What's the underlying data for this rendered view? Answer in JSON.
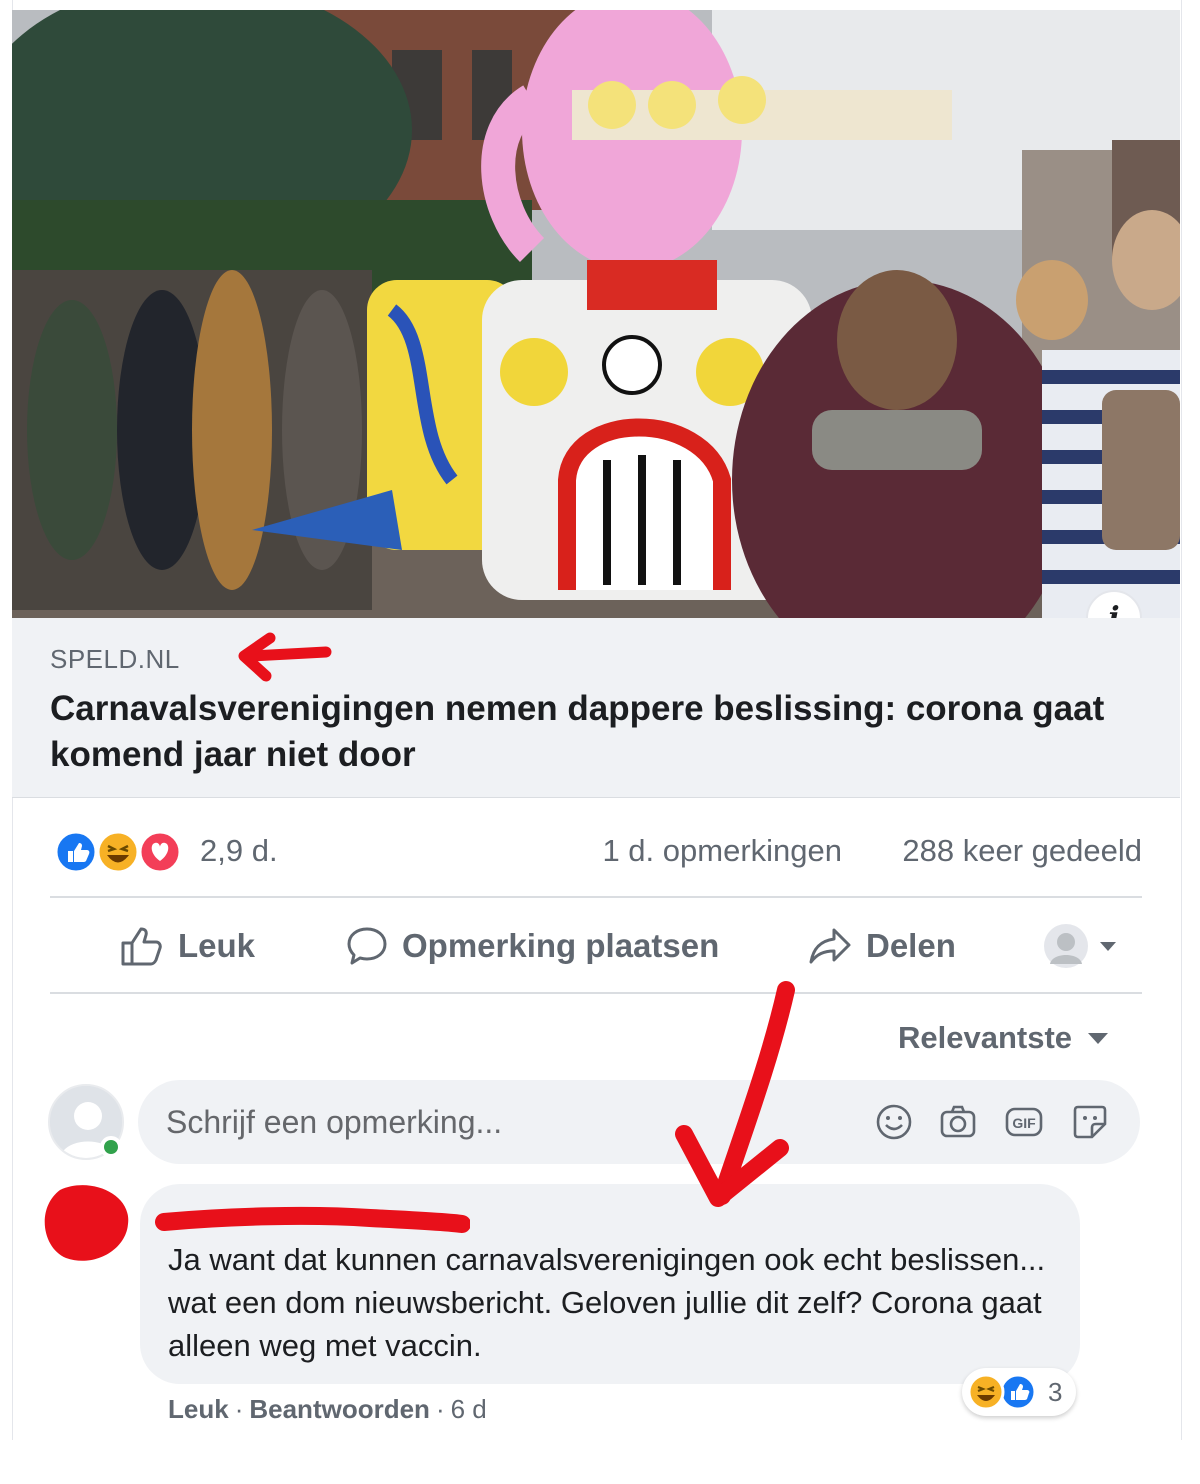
{
  "post": {
    "photo_alt": "",
    "info_icon": "i",
    "domain": "SPELD.NL",
    "headline": "Carnavalsverenigingen nemen dappere beslissing: corona gaat komend jaar niet door"
  },
  "stats": {
    "reactions": "2,9 d.",
    "comments": "1 d. opmerkingen",
    "shares": "288 keer gedeeld",
    "reaction_types": [
      "like-icon",
      "haha-icon",
      "love-icon"
    ]
  },
  "actions": {
    "like": "Leuk",
    "comment": "Opmerking plaatsen",
    "share": "Delen"
  },
  "sort_label": "Relevantste",
  "composer": {
    "placeholder": "Schrijf een opmerking...",
    "icons": [
      "emoji-icon",
      "camera-icon",
      "gif-icon",
      "sticker-icon"
    ]
  },
  "comment": {
    "text": "Ja want dat kunnen carnavalsverenigingen ook echt beslissen... wat een dom nieuwsbericht. Geloven jullie dit zelf? Corona gaat alleen weg met vaccin.",
    "reaction_count": "3",
    "like_label": "Leuk",
    "reply_label": "Beantwoorden",
    "time": "6 d",
    "sep": "·"
  },
  "colors": {
    "annotation_red": "#e8101a",
    "like_blue": "#1877f2",
    "love_red": "#f33e58",
    "haha_yellow": "#f7b125",
    "muted": "#606770"
  }
}
